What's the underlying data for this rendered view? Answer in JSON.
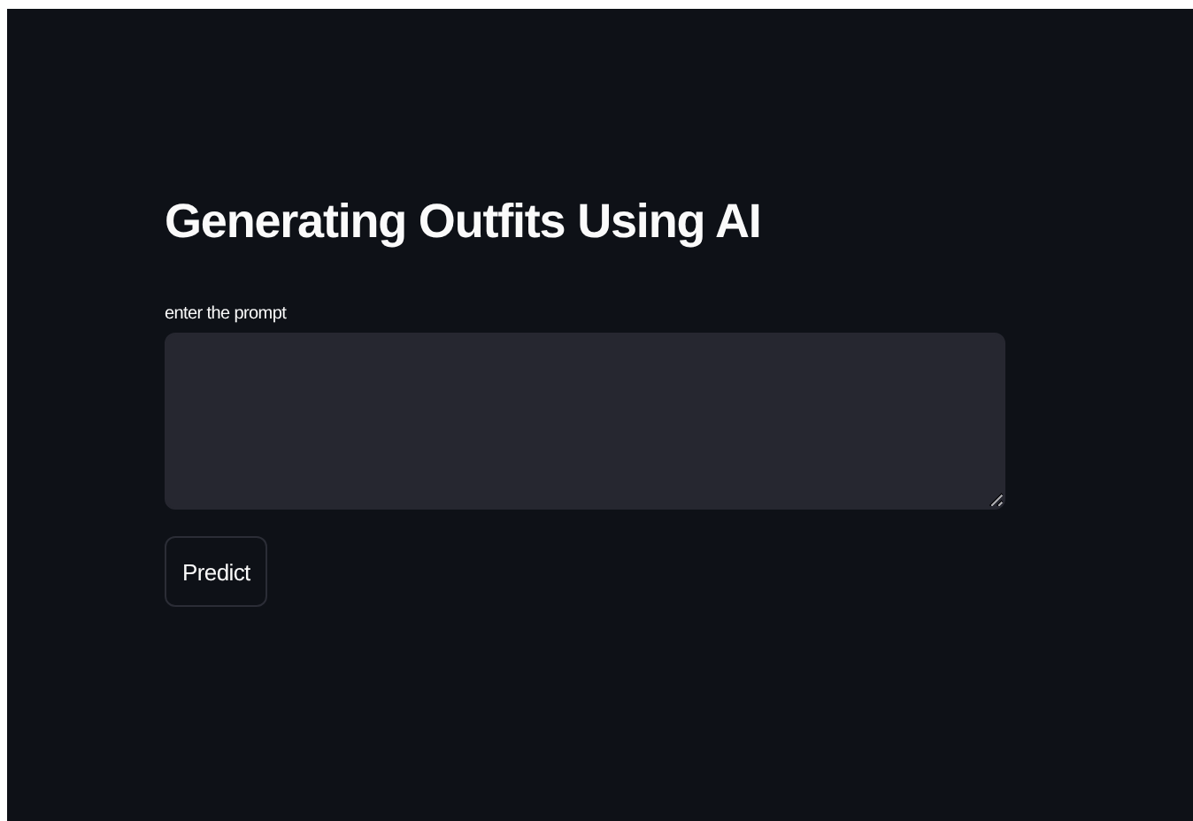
{
  "title": "Generating Outfits Using AI",
  "prompt_field": {
    "label": "enter the prompt"
  },
  "buttons": [
    {
      "label": "Predict"
    }
  ]
}
